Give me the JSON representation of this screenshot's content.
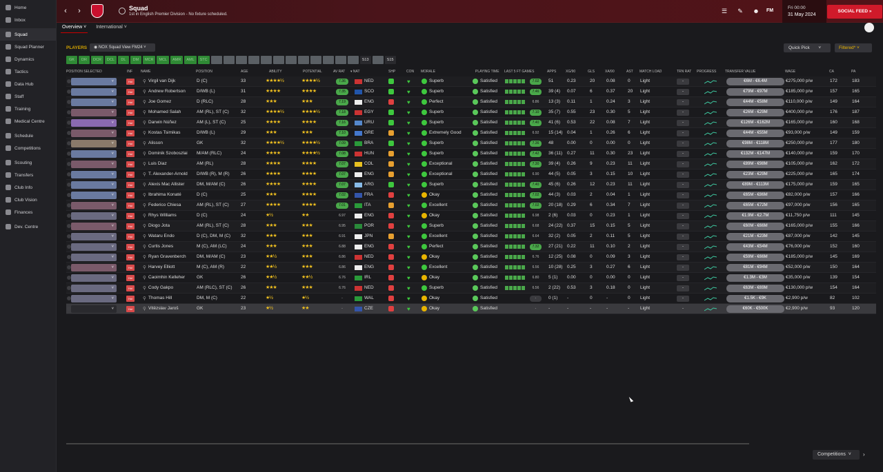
{
  "sidebar": [
    {
      "label": "Home"
    },
    {
      "label": "Inbox"
    },
    {
      "label": "Squad",
      "active": true
    },
    {
      "label": "Squad Planner"
    },
    {
      "label": "Dynamics"
    },
    {
      "label": "Tactics"
    },
    {
      "label": "Data Hub"
    },
    {
      "label": "Staff"
    },
    {
      "label": "Training"
    },
    {
      "label": "Medical Centre"
    },
    {
      "label": "Schedule"
    },
    {
      "label": "Competitions"
    },
    {
      "label": "Scouting"
    },
    {
      "label": "Transfers"
    },
    {
      "label": "Club Info"
    },
    {
      "label": "Club Vision"
    },
    {
      "label": "Finances"
    },
    {
      "label": "Dev. Centre"
    }
  ],
  "topbar": {
    "title": "Squad",
    "subtitle": "1st in English Premier Division - No fixture scheduled.",
    "time": "Fri 00:00",
    "date": "31 May 2024",
    "social": "SOCIAL FEED",
    "fm": "FM"
  },
  "subtabs": [
    {
      "label": "Overview ˅"
    },
    {
      "label": "International ˅"
    }
  ],
  "players_label": "PLAYERS",
  "view_select": "NOX Squad View FM24",
  "quick_pick": "Quick Pick",
  "filtered": "Filtered*",
  "filter_chips": [
    {
      "t": "GK",
      "s": "g"
    },
    {
      "t": "DR",
      "s": "g"
    },
    {
      "t": "DCR",
      "s": "g"
    },
    {
      "t": "DCL",
      "s": "g"
    },
    {
      "t": "DL",
      "s": "g"
    },
    {
      "t": "DM",
      "s": "g"
    },
    {
      "t": "MCR",
      "s": "g"
    },
    {
      "t": "MCL",
      "s": "g"
    },
    {
      "t": "AMR",
      "s": "g"
    },
    {
      "t": "AML",
      "s": "g"
    },
    {
      "t": "STC",
      "s": "g"
    },
    {
      "t": "",
      "s": "x"
    },
    {
      "t": "",
      "s": "x"
    },
    {
      "t": "",
      "s": "x"
    },
    {
      "t": "",
      "s": "x"
    },
    {
      "t": "",
      "s": "x"
    },
    {
      "t": "",
      "s": "x"
    },
    {
      "t": "",
      "s": "x"
    },
    {
      "t": "",
      "s": "x"
    },
    {
      "t": "",
      "s": "x"
    },
    {
      "t": "",
      "s": "x"
    },
    {
      "t": "",
      "s": "x"
    },
    {
      "t": "",
      "s": "x"
    },
    {
      "t": "S13",
      "s": "d"
    },
    {
      "t": "",
      "s": "x"
    },
    {
      "t": "S15",
      "s": "d"
    }
  ],
  "columns": {
    "position_selected": "POSITION SELECTED",
    "inf": "INF",
    "name": "NAME",
    "position": "POSITION",
    "age": "AGE",
    "ability": "ABILITY",
    "potential": "POTENTIAL",
    "av_rat": "AV RAT",
    "nat": "▾ NAT",
    "shp": "SHP",
    "con": "CON",
    "morale": "MORALE",
    "playing_time": "PLAYING TIME",
    "last5": "LAST 5 FT GAMES",
    "apps": "APPS",
    "xg90": "XG/90",
    "gls": "GLS",
    "xa90": "XA/90",
    "ast": "AST",
    "match_load": "MATCH LOAD",
    "trn_rat": "TRN RAT",
    "progress": "PROGRESS",
    "transfer_value": "TRANSFER VALUE",
    "wage": "WAGE",
    "ca": "CA",
    "pa": "PA"
  },
  "players": [
    {
      "name": "Virgil van Dijk",
      "pos": "D (C)",
      "age": "33",
      "ab": "★★★★½",
      "pot": "★★★★½",
      "avr": "7.36",
      "nat": "NED",
      "mor": "Superb",
      "pt": "Satisfied",
      "fav": "7.02",
      "apps": "51",
      "xg": "0.23",
      "gls": "20",
      "xa": "0.08",
      "ast": "0",
      "load": "Light",
      "trn": "-",
      "tv": "€6M - €6.4M",
      "wage": "€275,000 p/w",
      "ca": "172",
      "pa": "183"
    },
    {
      "name": "Andrew Robertson",
      "pos": "D/WB (L)",
      "age": "31",
      "ab": "★★★★",
      "pot": "★★★★",
      "avr": "7.35",
      "nat": "SCO",
      "mor": "Superb",
      "pt": "Satisfied",
      "fav": "7.46",
      "apps": "39 (4)",
      "xg": "0.07",
      "gls": "6",
      "xa": "0.37",
      "ast": "20",
      "load": "Light",
      "trn": "-",
      "tv": "€79M - €97M",
      "wage": "€185,000 p/w",
      "ca": "157",
      "pa": "165"
    },
    {
      "name": "Joe Gomez",
      "pos": "D (RLC)",
      "age": "28",
      "ab": "★★★",
      "pot": "★★★",
      "avr": "7.19",
      "nat": "ENG",
      "mor": "Perfect",
      "pt": "Satisfied",
      "fav": "6.86",
      "apps": "13 (3)",
      "xg": "0.11",
      "gls": "1",
      "xa": "0.24",
      "ast": "3",
      "load": "Light",
      "trn": "-",
      "tv": "€44M - €58M",
      "wage": "€110,000 p/w",
      "ca": "149",
      "pa": "164"
    },
    {
      "name": "Mohamed Salah",
      "pos": "AM (RL), ST (C)",
      "age": "32",
      "ab": "★★★★½",
      "pot": "★★★★½",
      "avr": "7.18",
      "nat": "EGY",
      "mor": "Superb",
      "pt": "Satisfied",
      "fav": "7.10",
      "apps": "35 (7)",
      "xg": "0.55",
      "gls": "23",
      "xa": "0.30",
      "ast": "5",
      "load": "Light",
      "trn": "-",
      "tv": "€26M - €29M",
      "wage": "€400,000 p/w",
      "ca": "176",
      "pa": "187"
    },
    {
      "name": "Darwin Núñez",
      "pos": "AM (L), ST (C)",
      "age": "25",
      "ab": "★★★★",
      "pot": "★★★★",
      "avr": "7.16",
      "nat": "URU",
      "mor": "Superb",
      "pt": "Satisfied",
      "fav": "7.40",
      "apps": "41 (6)",
      "xg": "0.53",
      "gls": "22",
      "xa": "0.08",
      "ast": "7",
      "load": "Light",
      "trn": "-",
      "tv": "€126M - €162M",
      "wage": "€165,000 p/w",
      "ca": "160",
      "pa": "168"
    },
    {
      "name": "Kostas Tsimikas",
      "pos": "D/WB (L)",
      "age": "29",
      "ab": "★★★",
      "pot": "★★★",
      "avr": "7.10",
      "nat": "GRE",
      "mor": "Extremely Good",
      "pt": "Satisfied",
      "fav": "6.92",
      "apps": "15 (14)",
      "xg": "0.04",
      "gls": "1",
      "xa": "0.26",
      "ast": "6",
      "load": "Light",
      "trn": "-",
      "tv": "€44M - €55M",
      "wage": "€93,000 p/w",
      "ca": "149",
      "pa": "159"
    },
    {
      "name": "Alisson",
      "pos": "GK",
      "age": "32",
      "ab": "★★★★½",
      "pot": "★★★★½",
      "avr": "7.09",
      "nat": "BRA",
      "mor": "Superb",
      "pt": "Satisfied",
      "fav": "7.36",
      "apps": "48",
      "xg": "0.00",
      "gls": "0",
      "xa": "0.00",
      "ast": "0",
      "load": "Light",
      "trn": "-",
      "tv": "€98M - €118M",
      "wage": "€250,000 p/w",
      "ca": "177",
      "pa": "180"
    },
    {
      "name": "Dominik Szoboszlai",
      "pos": "M/AM (RLC)",
      "age": "24",
      "ab": "★★★★",
      "pot": "★★★★½",
      "avr": "7.08",
      "nat": "HUN",
      "mor": "Superb",
      "pt": "Satisfied",
      "fav": "7.42",
      "apps": "36 (11)",
      "xg": "0.27",
      "gls": "11",
      "xa": "0.30",
      "ast": "23",
      "load": "Light",
      "trn": "-",
      "tv": "€132M - €147M",
      "wage": "€140,000 p/w",
      "ca": "159",
      "pa": "170"
    },
    {
      "name": "Luis Diaz",
      "pos": "AM (RL)",
      "age": "28",
      "ab": "★★★★",
      "pot": "★★★★",
      "avr": "7.07",
      "nat": "COL",
      "mor": "Exceptional",
      "pt": "Satisfied",
      "fav": "7.30",
      "apps": "39 (4)",
      "xg": "0.26",
      "gls": "9",
      "xa": "0.23",
      "ast": "11",
      "load": "Light",
      "trn": "-",
      "tv": "€89M - €98M",
      "wage": "€105,000 p/w",
      "ca": "162",
      "pa": "172"
    },
    {
      "name": "T. Alexander-Arnold",
      "pos": "D/WB (R), M (R)",
      "age": "26",
      "ab": "★★★★",
      "pot": "★★★★",
      "avr": "7.07",
      "nat": "ENG",
      "mor": "Exceptional",
      "pt": "Satisfied",
      "fav": "6.90",
      "apps": "44 (5)",
      "xg": "0.05",
      "gls": "3",
      "xa": "0.15",
      "ast": "10",
      "load": "Light",
      "trn": "-",
      "tv": "€23M - €29M",
      "wage": "€225,000 p/w",
      "ca": "165",
      "pa": "174"
    },
    {
      "name": "Alexis Mac Allister",
      "pos": "DM, M/AM (C)",
      "age": "26",
      "ab": "★★★★",
      "pot": "★★★★",
      "avr": "7.07",
      "nat": "ARG",
      "mor": "Superb",
      "pt": "Satisfied",
      "fav": "7.40",
      "apps": "45 (6)",
      "xg": "0.26",
      "gls": "12",
      "xa": "0.23",
      "ast": "11",
      "load": "Light",
      "trn": "-",
      "tv": "€89M - €113M",
      "wage": "€175,000 p/w",
      "ca": "159",
      "pa": "165"
    },
    {
      "name": "Ibrahima Konaté",
      "pos": "D (C)",
      "age": "25",
      "ab": "★★★",
      "pot": "★★★★",
      "avr": "7.02",
      "nat": "FRA",
      "mor": "Okay",
      "pt": "Satisfied",
      "fav": "7.02",
      "apps": "44 (3)",
      "xg": "0.03",
      "gls": "2",
      "xa": "0.04",
      "ast": "1",
      "load": "Light",
      "trn": "-",
      "tv": "€65M - €86M",
      "wage": "€82,000 p/w",
      "ca": "157",
      "pa": "166"
    },
    {
      "name": "Federico Chiesa",
      "pos": "AM (RL), ST (C)",
      "age": "27",
      "ab": "★★★★",
      "pot": "★★★★",
      "avr": "7.01",
      "nat": "ITA",
      "mor": "Excellent",
      "pt": "Satisfied",
      "fav": "7.02",
      "apps": "20 (18)",
      "xg": "0.29",
      "gls": "6",
      "xa": "0.34",
      "ast": "7",
      "load": "Light",
      "trn": "-",
      "tv": "€65M - €72M",
      "wage": "€97,000 p/w",
      "ca": "156",
      "pa": "165"
    },
    {
      "name": "Rhys Williams",
      "pos": "D (C)",
      "age": "24",
      "ab": "★½",
      "pot": "★★",
      "avr": "6.97",
      "nat": "ENG",
      "mor": "Okay",
      "pt": "Satisfied",
      "fav": "6.98",
      "apps": "2 (6)",
      "xg": "0.03",
      "gls": "0",
      "xa": "0.23",
      "ast": "1",
      "load": "Light",
      "trn": "-",
      "tv": "€1.9M - €2.7M",
      "wage": "€11,750 p/w",
      "ca": "111",
      "pa": "145"
    },
    {
      "name": "Diogo Jota",
      "pos": "AM (RL), ST (C)",
      "age": "28",
      "ab": "★★★",
      "pot": "★★★",
      "avr": "6.95",
      "nat": "POR",
      "mor": "Superb",
      "pt": "Satisfied",
      "fav": "6.68",
      "apps": "24 (22)",
      "xg": "0.37",
      "gls": "15",
      "xa": "0.15",
      "ast": "5",
      "load": "Light",
      "trn": "-",
      "tv": "€60M - €66M",
      "wage": "€165,000 p/w",
      "ca": "155",
      "pa": "166"
    },
    {
      "name": "Wataru Endo",
      "pos": "D (C), DM, M (C)",
      "age": "32",
      "ab": "★★★",
      "pot": "★★★",
      "avr": "6.91",
      "nat": "JPN",
      "mor": "Excellent",
      "pt": "Satisfied",
      "fav": "6.64",
      "apps": "32 (2)",
      "xg": "0.05",
      "gls": "2",
      "xa": "0.11",
      "ast": "5",
      "load": "Light",
      "trn": "-",
      "tv": "€21M - €23M",
      "wage": "€87,000 p/w",
      "ca": "142",
      "pa": "145"
    },
    {
      "name": "Curtis Jones",
      "pos": "M (C), AM (LC)",
      "age": "24",
      "ab": "★★★",
      "pot": "★★★",
      "avr": "6.88",
      "nat": "ENG",
      "mor": "Perfect",
      "pt": "Satisfied",
      "fav": "7.32",
      "apps": "27 (21)",
      "xg": "0.22",
      "gls": "11",
      "xa": "0.10",
      "ast": "2",
      "load": "Light",
      "trn": "-",
      "tv": "€43M - €54M",
      "wage": "€76,000 p/w",
      "ca": "152",
      "pa": "160"
    },
    {
      "name": "Ryan Gravenberch",
      "pos": "DM, M/AM (C)",
      "age": "23",
      "ab": "★★½",
      "pot": "★★★",
      "avr": "6.86",
      "nat": "NED",
      "mor": "Okay",
      "pt": "Satisfied",
      "fav": "6.76",
      "apps": "12 (25)",
      "xg": "0.08",
      "gls": "0",
      "xa": "0.09",
      "ast": "3",
      "load": "Light",
      "trn": "-",
      "tv": "€59M - €66M",
      "wage": "€185,000 p/w",
      "ca": "145",
      "pa": "169"
    },
    {
      "name": "Harvey Elliott",
      "pos": "M (C), AM (R)",
      "age": "22",
      "ab": "★★½",
      "pot": "★★★",
      "avr": "6.86",
      "nat": "ENG",
      "mor": "Excellent",
      "pt": "Satisfied",
      "fav": "6.56",
      "apps": "10 (28)",
      "xg": "0.25",
      "gls": "3",
      "xa": "0.27",
      "ast": "6",
      "load": "Light",
      "trn": "-",
      "tv": "€81M - €94M",
      "wage": "€52,000 p/w",
      "ca": "150",
      "pa": "164"
    },
    {
      "name": "Caoimhin Kelleher",
      "pos": "GK",
      "age": "26",
      "ab": "★★½",
      "pot": "★★½",
      "avr": "6.76",
      "nat": "IRL",
      "mor": "Okay",
      "pt": "Satisfied",
      "fav": "6.80",
      "apps": "5 (1)",
      "xg": "0.00",
      "gls": "0",
      "xa": "0.00",
      "ast": "0",
      "load": "Light",
      "trn": "-",
      "tv": "€1.3M - €3M",
      "wage": "€35,000 p/w",
      "ca": "139",
      "pa": "154"
    },
    {
      "name": "Cody Gakpo",
      "pos": "AM (RLC), ST (C)",
      "age": "26",
      "ab": "★★★",
      "pot": "★★★",
      "avr": "6.76",
      "nat": "NED",
      "mor": "Superb",
      "pt": "Satisfied",
      "fav": "6.56",
      "apps": "2 (22)",
      "xg": "0.53",
      "gls": "3",
      "xa": "0.18",
      "ast": "0",
      "load": "Light",
      "trn": "-",
      "tv": "€63M - €69M",
      "wage": "€130,000 p/w",
      "ca": "154",
      "pa": "164"
    },
    {
      "name": "Thomas Hill",
      "pos": "DM, M (C)",
      "age": "22",
      "ab": "★½",
      "pot": "★½",
      "avr": "-",
      "nat": "WAL",
      "mor": "Okay",
      "pt": "Satisfied",
      "fav": "-",
      "apps": "0 (1)",
      "xg": "-",
      "gls": "0",
      "xa": "-",
      "ast": "0",
      "load": "Light",
      "trn": "-",
      "tv": "€1.5K - €9K",
      "wage": "€2,900 p/w",
      "ca": "82",
      "pa": "102"
    },
    {
      "name": "Vitězslav Jaroš",
      "pos": "GK",
      "age": "23",
      "ab": "★½",
      "pot": "★★",
      "avr": "-",
      "nat": "CZE",
      "mor": "Okay",
      "pt": "Satisfied",
      "fav": "-",
      "apps": "-",
      "xg": "-",
      "gls": "-",
      "xa": "-",
      "ast": "-",
      "load": "Light",
      "trn": "-",
      "tv": "€60K - €500K",
      "wage": "€2,900 p/w",
      "ca": "93",
      "pa": "120"
    }
  ],
  "competitions": "Competitions",
  "colors": {
    "accent": "#d01a2a",
    "good": "#4aa84a",
    "star": "#f0c020"
  }
}
